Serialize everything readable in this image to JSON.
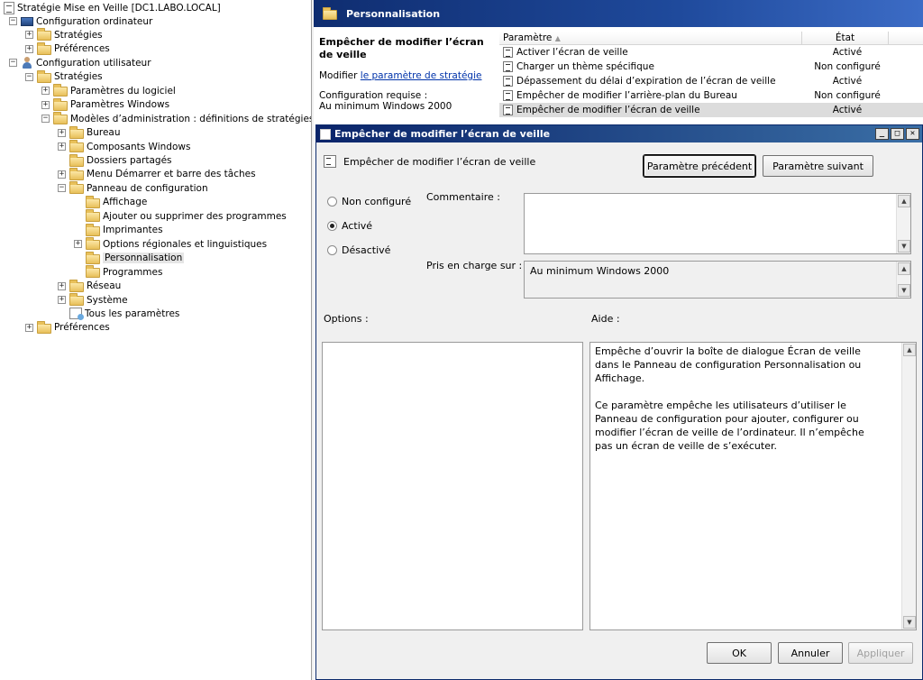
{
  "tree": {
    "root": "Stratégie Mise en Veille [DC1.LABO.LOCAL]",
    "items": [
      {
        "exp": "−",
        "icon": "pc",
        "label": "Configuration ordinateur"
      },
      {
        "exp": "+",
        "icon": "folder",
        "label": "Stratégies"
      },
      {
        "exp": "+",
        "icon": "folder",
        "label": "Préférences"
      },
      {
        "exp": "−",
        "icon": "user",
        "label": "Configuration utilisateur"
      },
      {
        "exp": "−",
        "icon": "folder",
        "label": "Stratégies"
      },
      {
        "exp": "+",
        "icon": "folder",
        "label": "Paramètres du logiciel"
      },
      {
        "exp": "+",
        "icon": "folder",
        "label": "Paramètres Windows"
      },
      {
        "exp": "−",
        "icon": "folder",
        "label": "Modèles d’administration : définitions de stratégies (fichie"
      },
      {
        "exp": "+",
        "icon": "folder",
        "label": "Bureau"
      },
      {
        "exp": "+",
        "icon": "folder",
        "label": "Composants Windows"
      },
      {
        "exp": "",
        "icon": "folder",
        "label": "Dossiers partagés"
      },
      {
        "exp": "+",
        "icon": "folder",
        "label": "Menu Démarrer et barre des tâches"
      },
      {
        "exp": "−",
        "icon": "folder",
        "label": "Panneau de configuration"
      },
      {
        "exp": "",
        "icon": "folder",
        "label": "Affichage"
      },
      {
        "exp": "",
        "icon": "folder",
        "label": "Ajouter ou supprimer des programmes"
      },
      {
        "exp": "",
        "icon": "folder",
        "label": "Imprimantes"
      },
      {
        "exp": "+",
        "icon": "folder",
        "label": "Options régionales et linguistiques"
      },
      {
        "exp": "",
        "icon": "folder",
        "label": "Personnalisation"
      },
      {
        "exp": "",
        "icon": "folder",
        "label": "Programmes"
      },
      {
        "exp": "+",
        "icon": "folder",
        "label": "Réseau"
      },
      {
        "exp": "+",
        "icon": "folder",
        "label": "Système"
      },
      {
        "exp": "",
        "icon": "allsettings",
        "label": "Tous les paramètres"
      },
      {
        "exp": "+",
        "icon": "folder",
        "label": "Préférences"
      }
    ]
  },
  "header": {
    "title": "Personnalisation"
  },
  "description": {
    "title": "Empêcher de modifier l’écran de veille",
    "edit_prefix": "Modifier ",
    "edit_link": "le paramètre de stratégie",
    "requirement_label": "Configuration requise :",
    "requirement_value": "Au minimum Windows 2000"
  },
  "list": {
    "col_param": "Paramètre",
    "col_state": "État",
    "rows": [
      {
        "name": "Activer l’écran de veille",
        "state": "Activé"
      },
      {
        "name": "Charger un thème spécifique",
        "state": "Non configuré"
      },
      {
        "name": "Dépassement du délai d’expiration de l’écran de veille",
        "state": "Activé"
      },
      {
        "name": "Empêcher de modifier l’arrière-plan du Bureau",
        "state": "Non configuré"
      },
      {
        "name": "Empêcher de modifier l’écran de veille",
        "state": "Activé"
      }
    ]
  },
  "dialog": {
    "title": "Empêcher de modifier l’écran de veille",
    "setting_name": "Empêcher de modifier l’écran de veille",
    "prev_button": "Paramètre précédent",
    "next_button": "Paramètre suivant",
    "radio_not_configured": "Non configuré",
    "radio_enabled": "Activé",
    "radio_disabled": "Désactivé",
    "selected_radio": "enabled",
    "comment_label": "Commentaire :",
    "comment_value": "",
    "supported_label": "Pris en charge sur :",
    "supported_value": "Au minimum Windows 2000",
    "options_label": "Options :",
    "help_label": "Aide :",
    "help_p1": "Empêche d’ouvrir la boîte de dialogue Écran de veille dans le Panneau de configuration Personnalisation ou Affichage.",
    "help_p2": "Ce paramètre empêche les utilisateurs d’utiliser le Panneau de configuration pour ajouter, configurer ou modifier l’écran de veille de l’ordinateur. Il n’empêche pas un écran de veille de s’exécuter.",
    "ok_button": "OK",
    "cancel_button": "Annuler",
    "apply_button": "Appliquer"
  }
}
